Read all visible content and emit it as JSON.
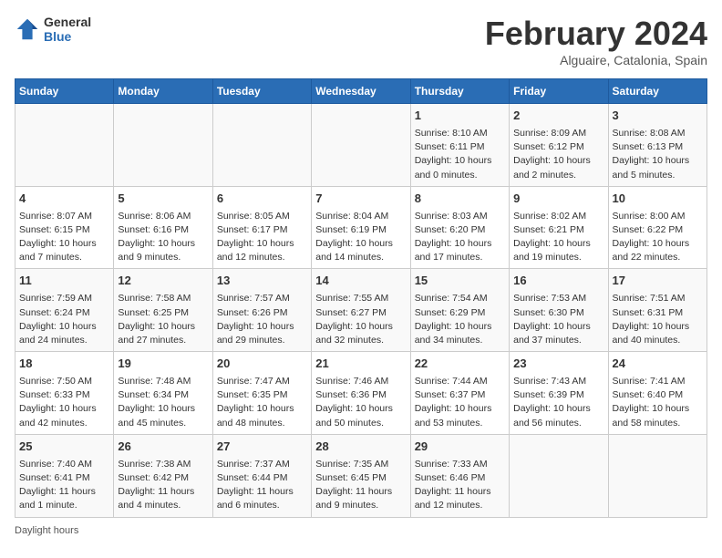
{
  "header": {
    "logo_general": "General",
    "logo_blue": "Blue",
    "month_title": "February 2024",
    "subtitle": "Alguaire, Catalonia, Spain"
  },
  "days_of_week": [
    "Sunday",
    "Monday",
    "Tuesday",
    "Wednesday",
    "Thursday",
    "Friday",
    "Saturday"
  ],
  "weeks": [
    [
      {
        "num": "",
        "info": ""
      },
      {
        "num": "",
        "info": ""
      },
      {
        "num": "",
        "info": ""
      },
      {
        "num": "",
        "info": ""
      },
      {
        "num": "1",
        "info": "Sunrise: 8:10 AM\nSunset: 6:11 PM\nDaylight: 10 hours and 0 minutes."
      },
      {
        "num": "2",
        "info": "Sunrise: 8:09 AM\nSunset: 6:12 PM\nDaylight: 10 hours and 2 minutes."
      },
      {
        "num": "3",
        "info": "Sunrise: 8:08 AM\nSunset: 6:13 PM\nDaylight: 10 hours and 5 minutes."
      }
    ],
    [
      {
        "num": "4",
        "info": "Sunrise: 8:07 AM\nSunset: 6:15 PM\nDaylight: 10 hours and 7 minutes."
      },
      {
        "num": "5",
        "info": "Sunrise: 8:06 AM\nSunset: 6:16 PM\nDaylight: 10 hours and 9 minutes."
      },
      {
        "num": "6",
        "info": "Sunrise: 8:05 AM\nSunset: 6:17 PM\nDaylight: 10 hours and 12 minutes."
      },
      {
        "num": "7",
        "info": "Sunrise: 8:04 AM\nSunset: 6:19 PM\nDaylight: 10 hours and 14 minutes."
      },
      {
        "num": "8",
        "info": "Sunrise: 8:03 AM\nSunset: 6:20 PM\nDaylight: 10 hours and 17 minutes."
      },
      {
        "num": "9",
        "info": "Sunrise: 8:02 AM\nSunset: 6:21 PM\nDaylight: 10 hours and 19 minutes."
      },
      {
        "num": "10",
        "info": "Sunrise: 8:00 AM\nSunset: 6:22 PM\nDaylight: 10 hours and 22 minutes."
      }
    ],
    [
      {
        "num": "11",
        "info": "Sunrise: 7:59 AM\nSunset: 6:24 PM\nDaylight: 10 hours and 24 minutes."
      },
      {
        "num": "12",
        "info": "Sunrise: 7:58 AM\nSunset: 6:25 PM\nDaylight: 10 hours and 27 minutes."
      },
      {
        "num": "13",
        "info": "Sunrise: 7:57 AM\nSunset: 6:26 PM\nDaylight: 10 hours and 29 minutes."
      },
      {
        "num": "14",
        "info": "Sunrise: 7:55 AM\nSunset: 6:27 PM\nDaylight: 10 hours and 32 minutes."
      },
      {
        "num": "15",
        "info": "Sunrise: 7:54 AM\nSunset: 6:29 PM\nDaylight: 10 hours and 34 minutes."
      },
      {
        "num": "16",
        "info": "Sunrise: 7:53 AM\nSunset: 6:30 PM\nDaylight: 10 hours and 37 minutes."
      },
      {
        "num": "17",
        "info": "Sunrise: 7:51 AM\nSunset: 6:31 PM\nDaylight: 10 hours and 40 minutes."
      }
    ],
    [
      {
        "num": "18",
        "info": "Sunrise: 7:50 AM\nSunset: 6:33 PM\nDaylight: 10 hours and 42 minutes."
      },
      {
        "num": "19",
        "info": "Sunrise: 7:48 AM\nSunset: 6:34 PM\nDaylight: 10 hours and 45 minutes."
      },
      {
        "num": "20",
        "info": "Sunrise: 7:47 AM\nSunset: 6:35 PM\nDaylight: 10 hours and 48 minutes."
      },
      {
        "num": "21",
        "info": "Sunrise: 7:46 AM\nSunset: 6:36 PM\nDaylight: 10 hours and 50 minutes."
      },
      {
        "num": "22",
        "info": "Sunrise: 7:44 AM\nSunset: 6:37 PM\nDaylight: 10 hours and 53 minutes."
      },
      {
        "num": "23",
        "info": "Sunrise: 7:43 AM\nSunset: 6:39 PM\nDaylight: 10 hours and 56 minutes."
      },
      {
        "num": "24",
        "info": "Sunrise: 7:41 AM\nSunset: 6:40 PM\nDaylight: 10 hours and 58 minutes."
      }
    ],
    [
      {
        "num": "25",
        "info": "Sunrise: 7:40 AM\nSunset: 6:41 PM\nDaylight: 11 hours and 1 minute."
      },
      {
        "num": "26",
        "info": "Sunrise: 7:38 AM\nSunset: 6:42 PM\nDaylight: 11 hours and 4 minutes."
      },
      {
        "num": "27",
        "info": "Sunrise: 7:37 AM\nSunset: 6:44 PM\nDaylight: 11 hours and 6 minutes."
      },
      {
        "num": "28",
        "info": "Sunrise: 7:35 AM\nSunset: 6:45 PM\nDaylight: 11 hours and 9 minutes."
      },
      {
        "num": "29",
        "info": "Sunrise: 7:33 AM\nSunset: 6:46 PM\nDaylight: 11 hours and 12 minutes."
      },
      {
        "num": "",
        "info": ""
      },
      {
        "num": "",
        "info": ""
      }
    ]
  ],
  "footer": "Daylight hours"
}
